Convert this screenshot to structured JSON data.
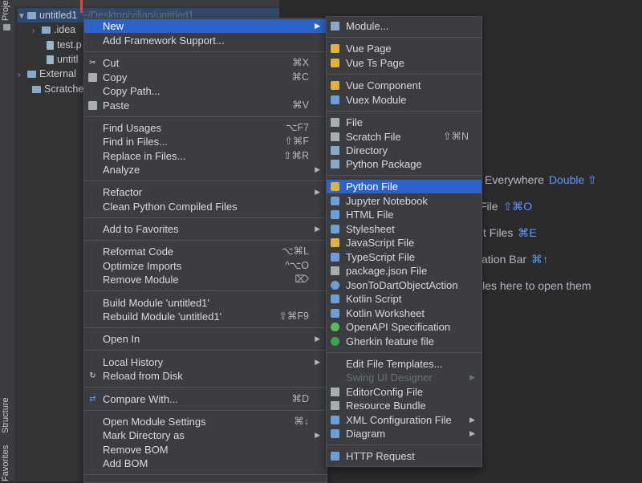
{
  "toolstrip": {
    "project_label": "Project",
    "structure_label": "Structure",
    "favorites_label": "Favorites"
  },
  "tree": {
    "rows": [
      {
        "label": "untitled1",
        "path": "~/Desktop/yilian/untitled1"
      },
      {
        "label": ".idea"
      },
      {
        "label": "test.p"
      },
      {
        "label": "untitl"
      },
      {
        "label": "External"
      },
      {
        "label": "Scratche"
      }
    ]
  },
  "editor_hints": [
    {
      "text": "Everywhere",
      "key": "Double ⇧"
    },
    {
      "text": "File",
      "key": "⇧⌘O"
    },
    {
      "text": "t Files",
      "key": "⌘E"
    },
    {
      "text": "ation Bar",
      "key": "⌘↑"
    },
    {
      "text": "iles here to open them",
      "key": ""
    }
  ],
  "context_menu": {
    "items": [
      {
        "label": "New",
        "shortcut": "",
        "submenu": true,
        "highlighted": true
      },
      {
        "label": "Add Framework Support...",
        "shortcut": ""
      },
      {
        "label": "Cut",
        "shortcut": "⌘X",
        "icon": "scissors-icon"
      },
      {
        "label": "Copy",
        "shortcut": "⌘C",
        "icon": "copy-icon"
      },
      {
        "label": "Copy Path...",
        "shortcut": ""
      },
      {
        "label": "Paste",
        "shortcut": "⌘V",
        "icon": "paste-icon"
      },
      {
        "label": "Find Usages",
        "shortcut": "⌥F7"
      },
      {
        "label": "Find in Files...",
        "shortcut": "⇧⌘F"
      },
      {
        "label": "Replace in Files...",
        "shortcut": "⇧⌘R"
      },
      {
        "label": "Analyze",
        "shortcut": "",
        "submenu": true
      },
      {
        "label": "Refactor",
        "shortcut": "",
        "submenu": true
      },
      {
        "label": "Clean Python Compiled Files",
        "shortcut": ""
      },
      {
        "label": "Add to Favorites",
        "shortcut": "",
        "submenu": true
      },
      {
        "label": "Reformat Code",
        "shortcut": "⌥⌘L"
      },
      {
        "label": "Optimize Imports",
        "shortcut": "^⌥O"
      },
      {
        "label": "Remove Module",
        "shortcut": "⌦"
      },
      {
        "label": "Build Module 'untitled1'",
        "shortcut": ""
      },
      {
        "label": "Rebuild Module 'untitled1'",
        "shortcut": "⇧⌘F9"
      },
      {
        "label": "Open In",
        "shortcut": "",
        "submenu": true
      },
      {
        "label": "Local History",
        "shortcut": "",
        "submenu": true
      },
      {
        "label": "Reload from Disk",
        "shortcut": "",
        "icon": "reload-icon"
      },
      {
        "label": "Compare With...",
        "shortcut": "⌘D",
        "icon": "compare-icon"
      },
      {
        "label": "Open Module Settings",
        "shortcut": "⌘↓"
      },
      {
        "label": "Mark Directory as",
        "shortcut": "",
        "submenu": true
      },
      {
        "label": "Remove BOM",
        "shortcut": ""
      },
      {
        "label": "Add BOM",
        "shortcut": ""
      }
    ]
  },
  "new_submenu": {
    "items": [
      {
        "label": "Module...",
        "shortcut": ""
      },
      {
        "label": "Vue Page",
        "shortcut": ""
      },
      {
        "label": "Vue Ts Page",
        "shortcut": ""
      },
      {
        "label": "Vue Component",
        "shortcut": ""
      },
      {
        "label": "Vuex Module",
        "shortcut": ""
      },
      {
        "label": "File",
        "shortcut": ""
      },
      {
        "label": "Scratch File",
        "shortcut": "⇧⌘N"
      },
      {
        "label": "Directory",
        "shortcut": ""
      },
      {
        "label": "Python Package",
        "shortcut": ""
      },
      {
        "label": "Python File",
        "shortcut": "",
        "highlighted": true
      },
      {
        "label": "Jupyter Notebook",
        "shortcut": ""
      },
      {
        "label": "HTML File",
        "shortcut": ""
      },
      {
        "label": "Stylesheet",
        "shortcut": ""
      },
      {
        "label": "JavaScript File",
        "shortcut": ""
      },
      {
        "label": "TypeScript File",
        "shortcut": ""
      },
      {
        "label": "package.json File",
        "shortcut": ""
      },
      {
        "label": "JsonToDartObjectAction",
        "shortcut": ""
      },
      {
        "label": "Kotlin Script",
        "shortcut": ""
      },
      {
        "label": "Kotlin Worksheet",
        "shortcut": ""
      },
      {
        "label": "OpenAPI Specification",
        "shortcut": ""
      },
      {
        "label": "Gherkin feature file",
        "shortcut": ""
      },
      {
        "label": "Edit File Templates...",
        "shortcut": ""
      },
      {
        "label": "Swing UI Designer",
        "shortcut": "",
        "submenu": true,
        "disabled": true
      },
      {
        "label": "EditorConfig File",
        "shortcut": ""
      },
      {
        "label": "Resource Bundle",
        "shortcut": ""
      },
      {
        "label": "XML Configuration File",
        "shortcut": "",
        "submenu": true
      },
      {
        "label": "Diagram",
        "shortcut": "",
        "submenu": true
      },
      {
        "label": "HTTP Request",
        "shortcut": ""
      }
    ]
  },
  "colors": {
    "highlight": "#2c62c9",
    "menu_bg": "#3b3d41",
    "editor_bg": "#2b2b2d",
    "shortcut_blue": "#5a9bff"
  }
}
